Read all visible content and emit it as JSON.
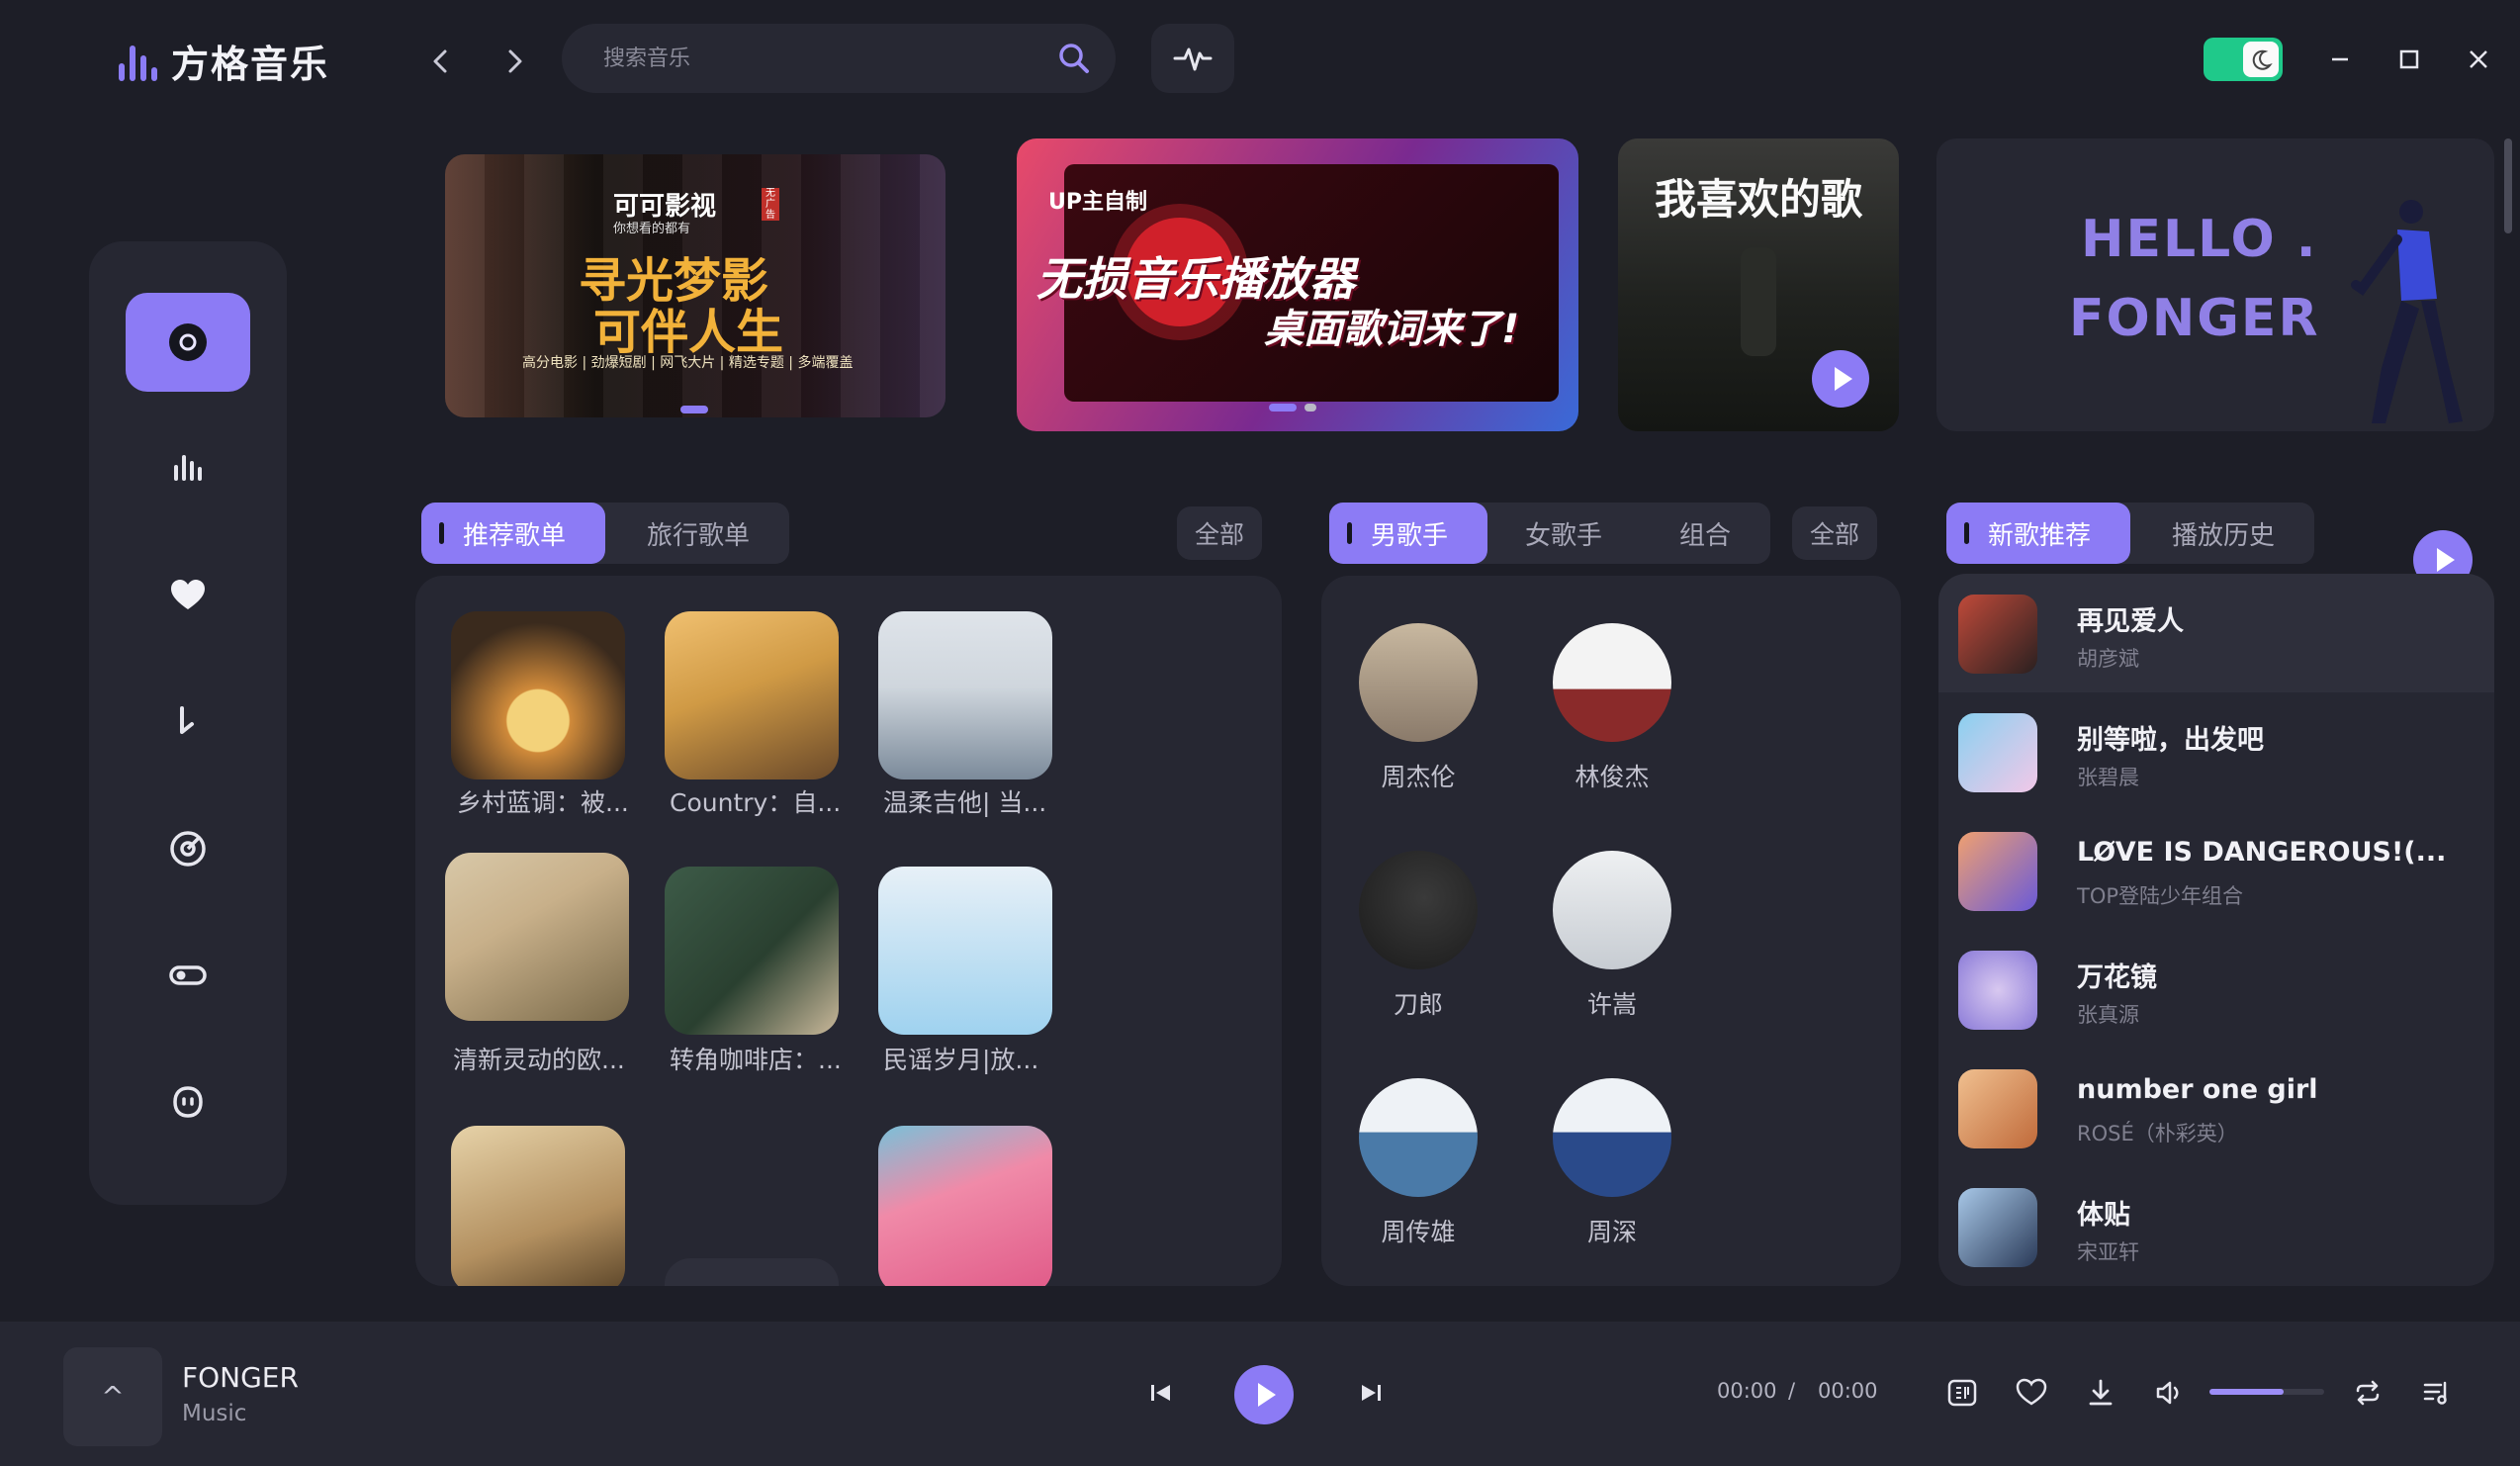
{
  "app": {
    "name": "方格音乐"
  },
  "search": {
    "placeholder": "搜索音乐"
  },
  "sidebar": {
    "items": [
      {
        "icon": "disc-icon",
        "active": true
      },
      {
        "icon": "chart-bars-icon",
        "active": false
      },
      {
        "icon": "heart-icon",
        "active": false
      },
      {
        "icon": "music-note-icon",
        "active": false
      },
      {
        "icon": "target-icon",
        "active": false
      },
      {
        "icon": "toggle-icon",
        "active": false
      },
      {
        "icon": "face-icon",
        "active": false
      }
    ]
  },
  "banners": {
    "b1": {
      "brand": "可可影视",
      "brand_sub": "你想看的都有",
      "brand_badge": "无广告",
      "headline1": "寻光梦影",
      "headline2": "可伴人生",
      "footer": "高分电影 | 劲爆短剧 | 网飞大片 | 精选专题 | 多端覆盖"
    },
    "b2": {
      "tag": "UP主自制",
      "headline1": "无损音乐播放器",
      "headline2": "桌面歌词来了!"
    },
    "b3": {
      "title": "我喜欢的歌"
    },
    "b4": {
      "line1": "HELLO .",
      "line2": "FONGER"
    }
  },
  "playlists": {
    "tabs": [
      "推荐歌单",
      "旅行歌单"
    ],
    "active_tab": 0,
    "all_label": "全部",
    "items": [
      {
        "label": "乡村蓝调：被...",
        "colors": [
          "#3a2a1d",
          "#d08a3a"
        ]
      },
      {
        "label": "Country：自...",
        "colors": [
          "#d09a45",
          "#6b4a2a"
        ]
      },
      {
        "label": "温柔吉他| 当...",
        "colors": [
          "#cfd6dd",
          "#7b8a9a"
        ]
      },
      {
        "label": "清新灵动的欧...",
        "colors": [
          "#c8b08a",
          "#7a6a4a"
        ]
      },
      {
        "label": "转角咖啡店：...",
        "colors": [
          "#3d5b48",
          "#c9b89a"
        ]
      },
      {
        "label": "民谣岁月|放...",
        "colors": [
          "#9fd2ef",
          "#e7f0f7"
        ]
      },
      {
        "label": "",
        "colors": [
          "#b39060",
          "#e6d2a8"
        ]
      },
      {
        "label": "",
        "colors": [
          "#f08aa8",
          "#7ac0d8"
        ]
      }
    ]
  },
  "singers": {
    "tabs": [
      "男歌手",
      "女歌手",
      "组合"
    ],
    "active_tab": 0,
    "all_label": "全部",
    "items": [
      {
        "name": "周杰伦",
        "colors": [
          "#8a7a6a",
          "#c8b8a0"
        ]
      },
      {
        "name": "林俊杰",
        "colors": [
          "#f3f3f3",
          "#8a2a2a"
        ]
      },
      {
        "name": "刀郎",
        "colors": [
          "#3a3a3a",
          "#1a1a1a"
        ]
      },
      {
        "name": "许嵩",
        "colors": [
          "#eef0f2",
          "#c7ccd2"
        ]
      },
      {
        "name": "周传雄",
        "colors": [
          "#eef2f6",
          "#4a7aa8"
        ]
      },
      {
        "name": "周深",
        "colors": [
          "#eef2f6",
          "#2a4a8a"
        ]
      }
    ]
  },
  "songs": {
    "tabs": [
      "新歌推荐",
      "播放历史"
    ],
    "active_tab": 0,
    "items": [
      {
        "title": "再见爱人",
        "artist": "胡彦斌",
        "colors": [
          "#2a2020",
          "#c04a3a"
        ]
      },
      {
        "title": "别等啦，出发吧",
        "artist": "张碧晨",
        "colors": [
          "#f2c8e8",
          "#8ad0f0"
        ]
      },
      {
        "title": "LØVE IS DANGEROUS!(...",
        "artist": "TOP登陆少年组合",
        "colors": [
          "#6a5ad8",
          "#f0a070"
        ]
      },
      {
        "title": "万花镜",
        "artist": "张真源",
        "colors": [
          "#8a7ad8",
          "#d8c8f0"
        ]
      },
      {
        "title": "number one girl",
        "artist": "ROSÉ（朴彩英）",
        "colors": [
          "#c06a3a",
          "#f0c090"
        ]
      },
      {
        "title": "体贴",
        "artist": "宋亚轩",
        "colors": [
          "#2a3a58",
          "#a8c8e8"
        ]
      }
    ]
  },
  "player": {
    "title": "FONGER",
    "subtitle": "Music",
    "cover_glyph": "^",
    "time_current": "00:00",
    "time_sep": "/",
    "time_total": "00:00",
    "volume": 0.65
  },
  "colors": {
    "accent": "#8c7bf5",
    "bg": "#1d1e27",
    "panel": "#262732",
    "toggle": "#1fc98a"
  }
}
